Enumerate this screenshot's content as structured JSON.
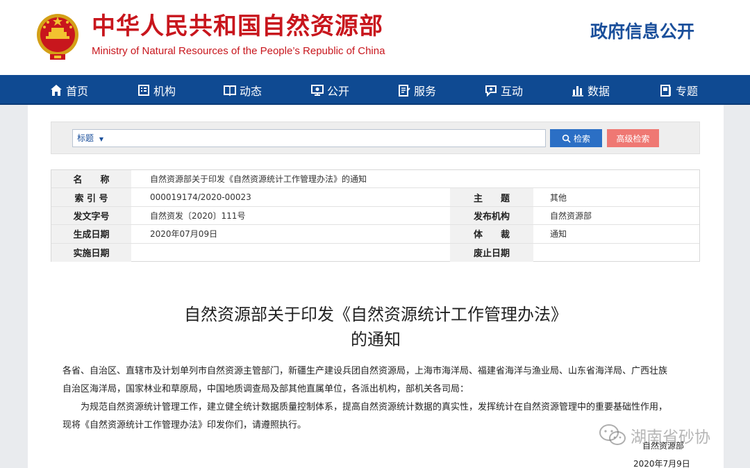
{
  "header": {
    "ministry_cn": "中华人民共和国自然资源部",
    "ministry_en": "Ministry of Natural Resources of the People’s Republic of China",
    "gov_info_open": "政府信息公开"
  },
  "nav": {
    "items": [
      {
        "label": "首页",
        "icon": "home-icon"
      },
      {
        "label": "机构",
        "icon": "organization-icon"
      },
      {
        "label": "动态",
        "icon": "news-icon"
      },
      {
        "label": "公开",
        "icon": "public-info-icon"
      },
      {
        "label": "服务",
        "icon": "service-icon"
      },
      {
        "label": "互动",
        "icon": "interaction-icon"
      },
      {
        "label": "数据",
        "icon": "data-chart-icon"
      },
      {
        "label": "专题",
        "icon": "topic-icon"
      }
    ]
  },
  "search": {
    "field_select": "标题",
    "search_button": "检索",
    "advanced_button": "高级检索"
  },
  "meta": {
    "name_label": "名　　称",
    "name_value": "自然资源部关于印发《自然资源统计工作管理办法》的通知",
    "index_label": "索 引 号",
    "index_value": "000019174/2020-00023",
    "subject_label": "主　　题",
    "subject_value": "其他",
    "doc_no_label": "发文字号",
    "doc_no_value": "自然资发〔2020〕111号",
    "issuer_label": "发布机构",
    "issuer_value": "自然资源部",
    "effective_label": "生成日期",
    "effective_value": "2020年07月09日",
    "genre_label": "体　　裁",
    "genre_value": "通知",
    "implement_label": "实施日期",
    "implement_value": "",
    "abolish_label": "废止日期",
    "abolish_value": ""
  },
  "article": {
    "title_line1": "自然资源部关于印发《自然资源统计工作管理办法》",
    "title_line2": "的通知",
    "para1_line1": "各省、自治区、直辖市及计划单列市自然资源主管部门，新疆生产建设兵团自然资源局，上海市海洋局、福建省海洋与渔业局、山东省海洋局、广西壮族",
    "para1_line2": "自治区海洋局，国家林业和草原局，中国地质调查局及部其他直属单位，各派出机构，部机关各司局：",
    "para2_line1": "为规范自然资源统计管理工作，建立健全统计数据质量控制体系，提高自然资源统计数据的真实性，发挥统计在自然资源管理中的重要基础性作用，",
    "para2_line2": "现将《自然资源统计工作管理办法》印发你们，请遵照执行。",
    "signer": "自然资源部",
    "date": "2020年7月9日"
  },
  "watermark": {
    "text": "湖南省砂协",
    "icon": "wechat-icon"
  },
  "colors": {
    "brand_red": "#c8161d",
    "nav_blue": "#0f4a92",
    "search_blue": "#2b6fc5",
    "advanced_pink": "#ef7873"
  }
}
